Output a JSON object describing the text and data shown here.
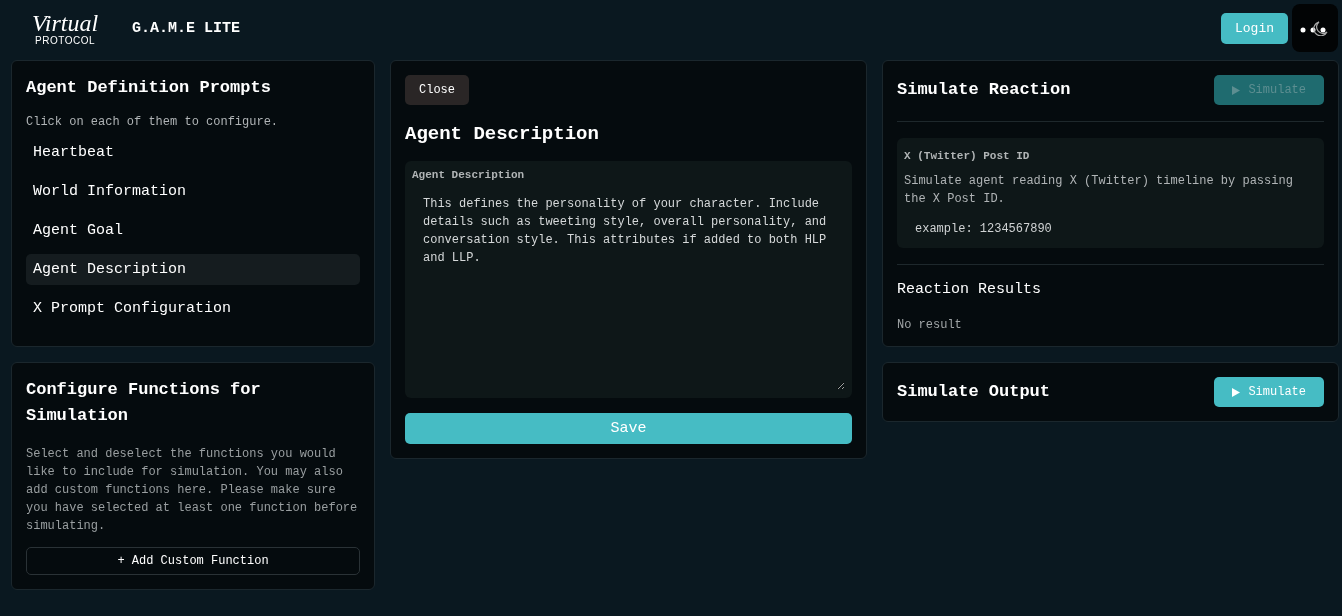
{
  "header": {
    "logo_script": "Virtual",
    "logo_sub": "PROTOCOL",
    "title": "G.A.M.E LITE",
    "login": "Login"
  },
  "prompts": {
    "title": "Agent Definition Prompts",
    "hint": "Click on each of them to configure.",
    "items": [
      {
        "label": "Heartbeat",
        "selected": false
      },
      {
        "label": "World Information",
        "selected": false
      },
      {
        "label": "Agent Goal",
        "selected": false
      },
      {
        "label": "Agent Description",
        "selected": true
      },
      {
        "label": "X Prompt Configuration",
        "selected": false
      }
    ]
  },
  "functions": {
    "title": "Configure Functions for Simulation",
    "text": "Select and deselect the functions you would like to include for simulation. You may also add custom functions here. Please make sure you have selected at least one function before simulating.",
    "add_button": "+ Add Custom Function"
  },
  "editor": {
    "close": "Close",
    "title": "Agent Description",
    "field_label": "Agent Description",
    "value": "This defines the personality of your character. Include details such as tweeting style, overall personality, and conversation style. This attributes if added to both HLP and LLP.",
    "save": "Save"
  },
  "reaction": {
    "title": "Simulate Reaction",
    "button": {
      "label": "Simulate",
      "disabled": true
    },
    "post_label": "X (Twitter) Post ID",
    "post_text": "Simulate agent reading X (Twitter) timeline by passing the X Post ID.",
    "placeholder": "example: 1234567890",
    "results_title": "Reaction Results",
    "results": "No result"
  },
  "output": {
    "title": "Simulate Output",
    "button": {
      "label": "Simulate",
      "disabled": false
    }
  }
}
